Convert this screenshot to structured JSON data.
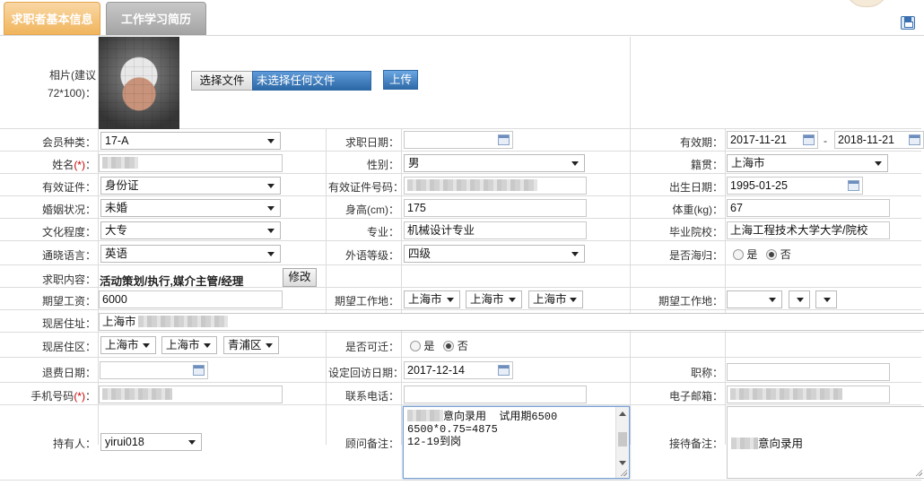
{
  "tabs": [
    {
      "label": "求职者基本信息"
    },
    {
      "label": "工作学习简历"
    }
  ],
  "photo": {
    "label": "相片(建议72*100)：",
    "choose_file": "选择文件",
    "no_file": "未选择任何文件",
    "upload": "上传"
  },
  "member_type": {
    "label": "会员种类：",
    "value": "17-A"
  },
  "job_date": {
    "label": "求职日期：",
    "value": ""
  },
  "validity": {
    "label": "有效期：",
    "start": "2017-11-21",
    "sep": "-",
    "end": "2018-11-21"
  },
  "name": {
    "label": "姓名",
    "req": "(*)",
    "colon": "："
  },
  "gender": {
    "label": "性别：",
    "value": "男"
  },
  "native_place": {
    "label": "籍贯：",
    "value": "上海市"
  },
  "id_type": {
    "label": "有效证件：",
    "value": "身份证"
  },
  "id_number": {
    "label": "有效证件号码："
  },
  "birth_date": {
    "label": "出生日期：",
    "value": "1995-01-25"
  },
  "marital": {
    "label": "婚姻状况：",
    "value": "未婚"
  },
  "height": {
    "label": "身高(cm)：",
    "value": "175"
  },
  "weight": {
    "label": "体重(kg)：",
    "value": "67"
  },
  "education": {
    "label": "文化程度：",
    "value": "大专"
  },
  "major": {
    "label": "专业：",
    "value": "机械设计专业"
  },
  "school": {
    "label": "毕业院校：",
    "value": "上海工程技术大学大学/院校"
  },
  "language": {
    "label": "通晓语言：",
    "value": "英语"
  },
  "language_level": {
    "label": "外语等级：",
    "value": "四级"
  },
  "returnee": {
    "label": "是否海归：",
    "yes": "是",
    "no": "否",
    "selected": "否"
  },
  "job_content": {
    "label": "求职内容：",
    "value": "活动策划/执行,媒介主管/经理",
    "edit": "修改"
  },
  "salary": {
    "label": "期望工资：",
    "value": "6000"
  },
  "work_place_1": {
    "label": "期望工作地：",
    "province": "上海市",
    "city": "上海市",
    "district": "上海市"
  },
  "work_place_2": {
    "label": "期望工作地：",
    "province": "",
    "city": "",
    "district": ""
  },
  "address": {
    "label": "现居住址：",
    "value": "上海市"
  },
  "residence": {
    "label": "现居住区：",
    "province": "上海市",
    "city": "上海市",
    "district": "青浦区"
  },
  "relocate": {
    "label": "是否可迁：",
    "yes": "是",
    "no": "否",
    "selected": "否"
  },
  "refund_date": {
    "label": "退费日期：",
    "value": ""
  },
  "revisit_date": {
    "label": "设定回访日期：",
    "value": "2017-12-14"
  },
  "title": {
    "label": "职称：",
    "value": ""
  },
  "mobile": {
    "label": "手机号码",
    "req": "(*)",
    "colon": "："
  },
  "phone": {
    "label": "联系电话：",
    "value": ""
  },
  "email": {
    "label": "电子邮箱："
  },
  "holder": {
    "label": "持有人：",
    "value": "yirui018"
  },
  "consultant_note": {
    "label": "顾问备注：",
    "lines": [
      "意向录用  试用期6500",
      "6500*0.75=4875",
      "12-19到岗"
    ]
  },
  "reception_note": {
    "label": "接待备注：",
    "value": "意向录用"
  }
}
